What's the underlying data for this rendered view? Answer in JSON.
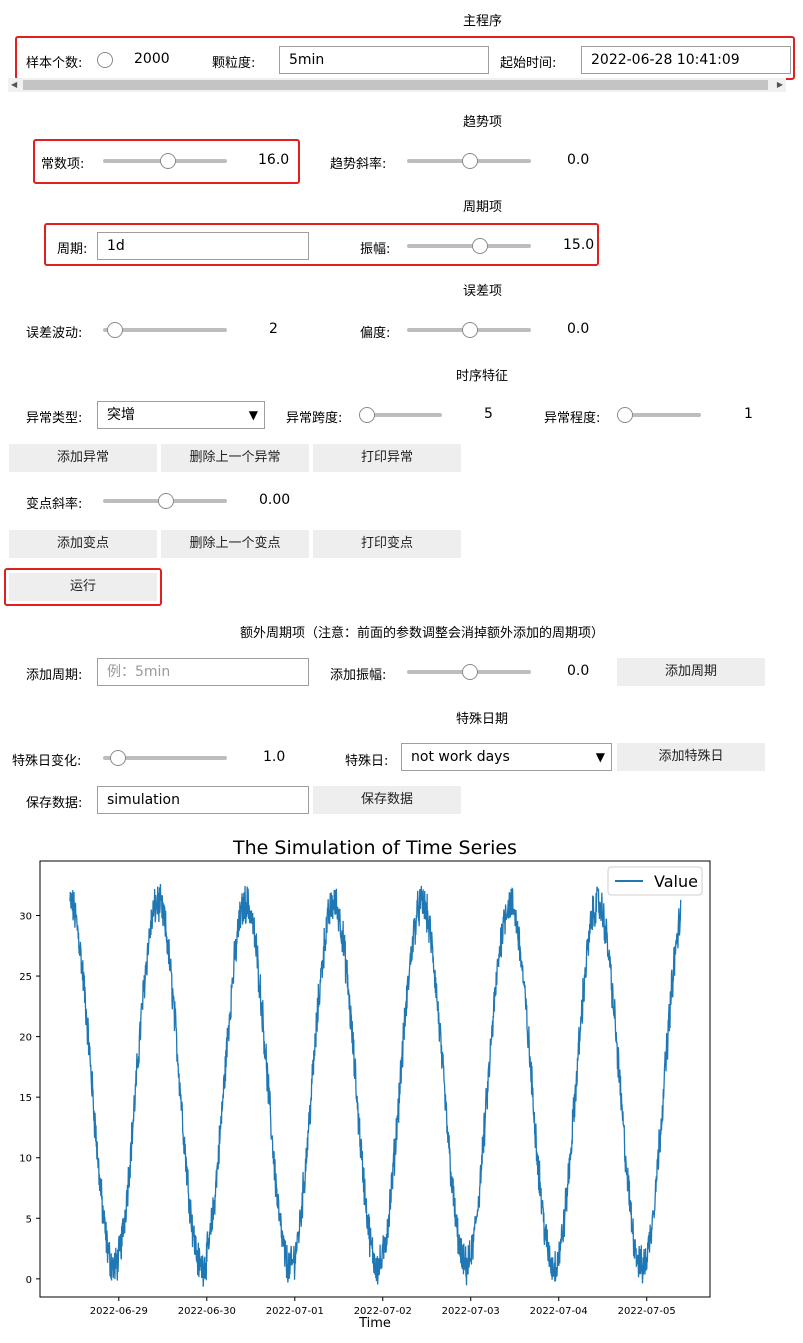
{
  "main": {
    "title": "主程序",
    "sample_label": "样本个数:",
    "sample_value": "2000",
    "granularity_label": "颗粒度:",
    "granularity_value": "5min",
    "start_label": "起始时间:",
    "start_value": "2022-06-28 10:41:09"
  },
  "trend": {
    "title": "趋势项",
    "const_label": "常数项:",
    "const_value": "16.0",
    "slope_label": "趋势斜率:",
    "slope_value": "0.0"
  },
  "period": {
    "title": "周期项",
    "period_label": "周期:",
    "period_value": "1d",
    "amp_label": "振幅:",
    "amp_value": "15.0"
  },
  "error": {
    "title": "误差项",
    "noise_label": "误差波动:",
    "noise_value": "2",
    "bias_label": "偏度:",
    "bias_value": "0.0"
  },
  "features": {
    "title": "时序特征",
    "anomaly_type_label": "异常类型:",
    "anomaly_type_value": "突增",
    "anomaly_span_label": "异常跨度:",
    "anomaly_span_value": "5",
    "anomaly_degree_label": "异常程度:",
    "anomaly_degree_value": "1",
    "add_anomaly": "添加异常",
    "del_anomaly": "删除上一个异常",
    "print_anomaly": "打印异常",
    "cp_slope_label": "变点斜率:",
    "cp_slope_value": "0.00",
    "add_cp": "添加变点",
    "del_cp": "删除上一个变点",
    "print_cp": "打印变点",
    "run": "运行"
  },
  "extra": {
    "title": "额外周期项（注意：前面的参数调整会消掉额外添加的周期项）",
    "add_period_label": "添加周期:",
    "add_period_placeholder": "例：5min",
    "add_amp_label": "添加振幅:",
    "add_amp_value": "0.0",
    "add_period_button": "添加周期"
  },
  "special": {
    "title": "特殊日期",
    "change_label": "特殊日变化:",
    "change_value": "1.0",
    "day_label": "特殊日:",
    "day_value": "not work days",
    "add_button": "添加特殊日",
    "save_label": "保存数据:",
    "save_value": "simulation",
    "save_button": "保存数据"
  },
  "colors": {
    "accent_box": "#e0201e",
    "series": "#1f77b4"
  },
  "chart_data": {
    "type": "line",
    "title": "The Simulation of Time Series",
    "xlabel": "Time",
    "ylabel": "",
    "legend": [
      "Value"
    ],
    "legend_position": "top-right",
    "x_start": "2022-06-28 10:41:09",
    "x_step": "5min",
    "n_points": 2000,
    "x_ticks": [
      "2022-06-29",
      "2022-06-30",
      "2022-07-01",
      "2022-07-02",
      "2022-07-03",
      "2022-07-04",
      "2022-07-05"
    ],
    "y_ticks": [
      0,
      5,
      10,
      15,
      20,
      25,
      30
    ],
    "ylim": [
      -1.5,
      34.5
    ],
    "series": [
      {
        "name": "Value",
        "description": "Daily sinusoid: baseline 16, amplitude 15, period 1 day, with noise (±2)",
        "peak_times": [
          "2022-06-28 10:45",
          "2022-06-29 10:45",
          "2022-06-30 10:45",
          "2022-07-01 10:45",
          "2022-07-02 10:45",
          "2022-07-03 10:45",
          "2022-07-04 10:45"
        ],
        "trough_times": [
          "2022-06-28 22:45",
          "2022-06-29 22:45",
          "2022-06-30 22:45",
          "2022-07-01 22:45",
          "2022-07-02 22:45",
          "2022-07-03 22:45",
          "2022-07-04 22:45"
        ],
        "max": 33.2,
        "min": -0.6,
        "last_value": 30.6
      }
    ]
  }
}
